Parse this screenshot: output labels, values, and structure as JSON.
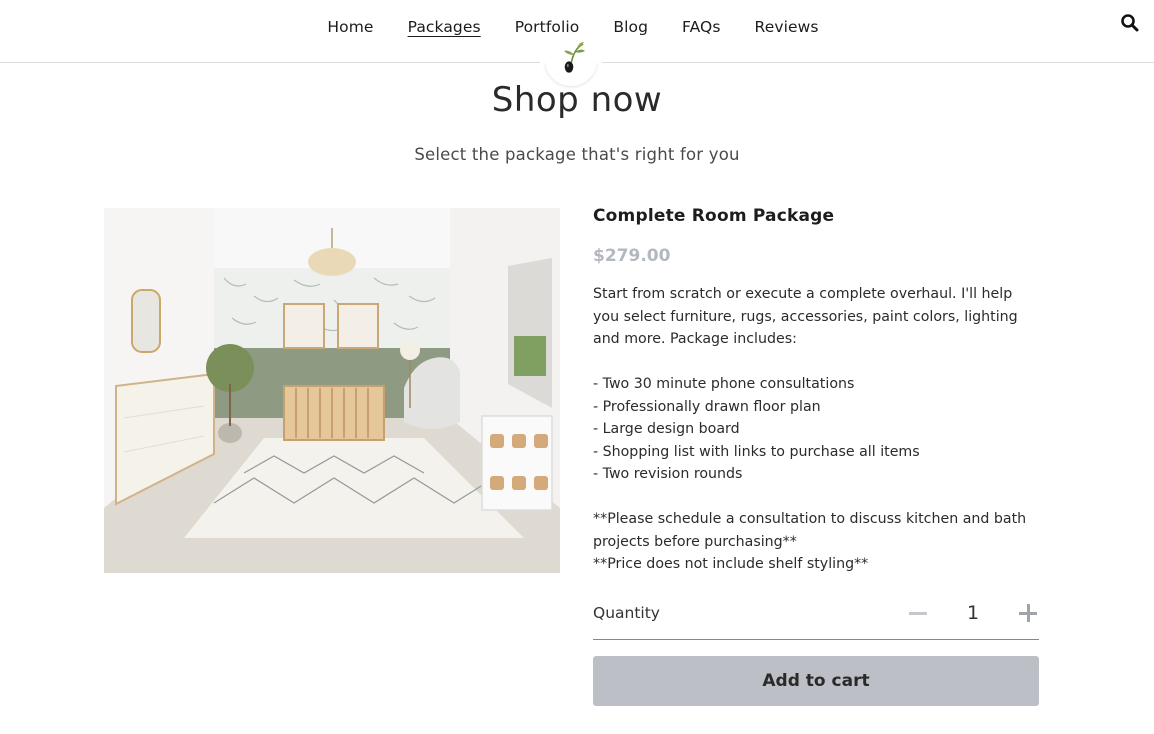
{
  "nav": {
    "items": [
      {
        "label": "Home"
      },
      {
        "label": "Packages"
      },
      {
        "label": "Portfolio"
      },
      {
        "label": "Blog"
      },
      {
        "label": "FAQs"
      },
      {
        "label": "Reviews"
      }
    ],
    "active": "Packages",
    "search_icon": "search-icon",
    "logo_icon": "olive-branch-logo"
  },
  "hero": {
    "title": "Shop now",
    "subtitle": "Select the package that's right for you"
  },
  "product": {
    "name": "Complete Room Package",
    "price": "$279.00",
    "description": [
      "Start from scratch or execute a complete overhaul. I'll help you select furniture, rugs, accessories, paint colors, lighting and more. Package includes:",
      "",
      "- Two 30 minute phone consultations",
      "- Professionally drawn floor plan",
      "- Large design board",
      "- Shopping list with links to purchase all items",
      "- Two revision rounds",
      "",
      "**Please schedule a consultation to discuss kitchen and bath projects before purchasing**",
      "**Price does not include shelf styling**"
    ],
    "image_alt": "Nursery room rendering",
    "quantity_label": "Quantity",
    "quantity": "1",
    "add_to_cart_label": "Add to cart"
  },
  "colors": {
    "price": "#b3b8bf",
    "button_bg": "#bcc0c6",
    "wall_accent": "#8e9a82"
  }
}
